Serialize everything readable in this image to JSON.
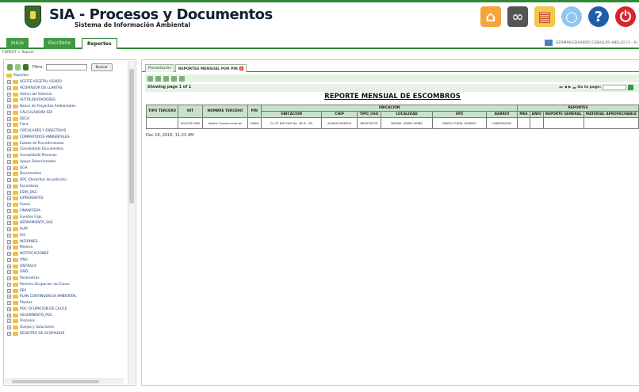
{
  "header": {
    "title": "SIA - Procesos y Documentos",
    "subtitle": "Sistema de Información Ambiental"
  },
  "nav": {
    "inicio": "Inicio",
    "escritorio": "Escritorio",
    "reportes": "Reportes",
    "user": "GERMAN EDUARDO CEBALLOS ABELLO (3 - A)",
    "breadcrumb": "FOREST > Report"
  },
  "left": {
    "filter_label": "Filtro:",
    "search_button": "Buscar",
    "root": "Reportes",
    "items": [
      "ACEITE VEGETAL USADO",
      "ACOPIADOR DE LLANTAS",
      "Admin del Sistema",
      "AUTOLIQUIDADORES",
      "Banco de Proyectos Ambientales",
      "CALCULADORA SDI",
      "DECA",
      "Flora",
      "CIRCULARES Y DIRECTRIAS",
      "COMPARTIDOS AMBIENTALES",
      "Estado de Procedimientos",
      "Consolidado Documentos",
      "Consolidado Procesos",
      "Apoyo Seleccionados",
      "DGA",
      "Documentos",
      "DPC (Derechos de petición)",
      "Escombros",
      "ESPA_DSC",
      "EXPEDIENTES",
      "Fauna",
      "FINANCIERA",
      "Fuentes Fijas",
      "HERRAMIENTA_SAE",
      "IAAP",
      "IAS",
      "INFORMES",
      "Mineria",
      "NOTIFICACIONES",
      "ONG",
      "ONTRACA",
      "OREL",
      "Parametros",
      "Permiso Ocupacion de Cauce",
      "PEV",
      "PLAN CONTINGENCIA AMBIENTAL",
      "Plantas",
      "POC OCUPACION DE CAUCE",
      "SEGUIMIENTO_POC",
      "Procesos",
      "Quejas y Soluciones",
      "REGISTRO DE ACOPIADOR"
    ]
  },
  "content": {
    "tab_presentacion": "Presentación",
    "tab_active": "REPORTES MENSUAL POR PIN",
    "showing": "Showing page 1 of 1",
    "go_to_page": "Go to page:",
    "report_title": "REPORTE MENSUAL DE ESCOMBROS",
    "timestamp": "Dec 16, 2016, 11:23 AM",
    "group_headers": {
      "ubicacion": "UBICACION",
      "reportes": "REPORTES"
    },
    "columns": {
      "tipo_tercero": "TIPO TERCERO",
      "nit": "NIT",
      "nombre_tercero": "NOMBRE TERCERO",
      "pin": "PIN",
      "ubicacion": "UBICACION",
      "chip": "CHIP",
      "tipo_uso": "TIPO_USO",
      "localidad": "LOCALIDAD",
      "upz": "UPZ",
      "barrio": "BARRIO",
      "mes": "MES",
      "anio": "AÑIO",
      "reporte_general": "REPORTE GENERAL",
      "material_aprovechable": "MATERIAL APROVECHABLE"
    },
    "row": {
      "tipo_tercero": "",
      "nit": "9010331460",
      "nombre_tercero": "Albine Construcciones",
      "pin": "15800",
      "ubicacion": "CL 27 BIS SUR No. 26 D - 83",
      "chip": "AAA0010R8500",
      "tipo_uso": "REESTATOS",
      "localidad": "RAFAEL URIBE URIBE",
      "upz": "MARCO FIDEL SUAREZ",
      "barrio": "LIBERTADOR",
      "mes": "",
      "anio": "",
      "reporte_general": "",
      "material_aprovechable": ""
    }
  },
  "colors": {
    "brand_green": "#2f8a34",
    "header_cell": "#c8e2c8"
  }
}
